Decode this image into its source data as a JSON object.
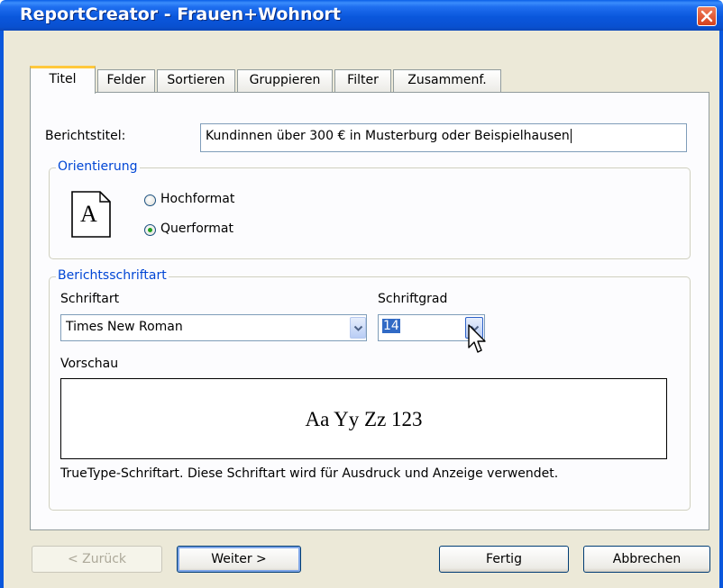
{
  "window": {
    "title": "ReportCreator - Frauen+Wohnort"
  },
  "tabs": [
    {
      "label": "Titel",
      "active": true
    },
    {
      "label": "Felder",
      "active": false
    },
    {
      "label": "Sortieren",
      "active": false
    },
    {
      "label": "Gruppieren",
      "active": false
    },
    {
      "label": "Filter",
      "active": false
    },
    {
      "label": "Zusammenf.",
      "active": false
    }
  ],
  "report_title": {
    "label": "Berichtstitel:",
    "value": "Kundinnen über 300 € in Musterburg oder Beispielhausen"
  },
  "orientation": {
    "legend": "Orientierung",
    "icon_letter": "A",
    "options": [
      {
        "label": "Hochformat",
        "selected": false
      },
      {
        "label": "Querformat",
        "selected": true
      }
    ]
  },
  "font": {
    "legend": "Berichtsschriftart",
    "family_label": "Schriftart",
    "family_value": "Times New Roman",
    "size_label": "Schriftgrad",
    "size_value": "14",
    "preview_label": "Vorschau",
    "preview_text": "Aa Yy Zz 123",
    "description": "TrueType-Schriftart. Diese Schriftart wird für Ausdruck und Anzeige verwendet."
  },
  "buttons": {
    "back": "< Zurück",
    "next": "Weiter >",
    "finish": "Fertig",
    "cancel": "Abbrechen"
  },
  "colors": {
    "titlebar": "#0a57dc",
    "group_legend": "#0046d5",
    "tab_highlight": "#ffc83c",
    "radio_dot": "#21a121",
    "selection": "#316ac5"
  }
}
